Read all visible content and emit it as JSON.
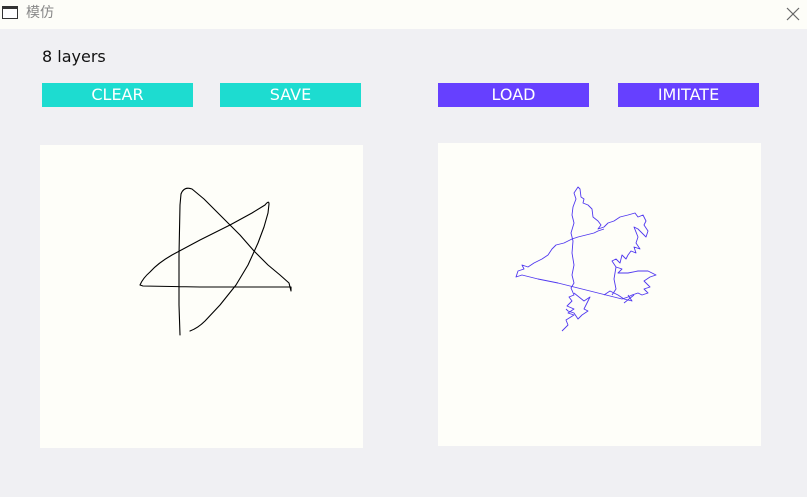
{
  "window": {
    "title": "模仿"
  },
  "status": {
    "layers_text": "8 layers"
  },
  "toolbar": {
    "clear_label": "CLEAR",
    "save_label": "SAVE",
    "load_label": "LOAD",
    "imitate_label": "IMITATE"
  },
  "colors": {
    "primary_button": "#1ddcd0",
    "secondary_button": "#6640ff",
    "drawing_stroke": "#000000",
    "imitation_stroke": "#5038f0",
    "canvas_background": "#fefef9",
    "window_background": "#f0f0f3"
  },
  "icons": {
    "app": "window-icon",
    "close": "close-icon"
  }
}
